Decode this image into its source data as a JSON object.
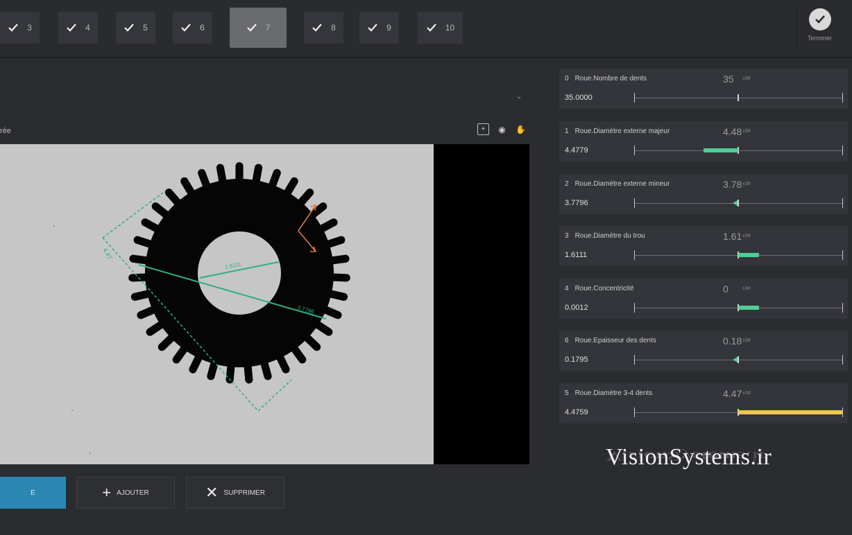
{
  "steps": [
    {
      "num": "3",
      "active": false
    },
    {
      "num": "4",
      "active": false
    },
    {
      "num": "5",
      "active": false
    },
    {
      "num": "6",
      "active": false
    },
    {
      "num": "7",
      "active": true
    },
    {
      "num": "8",
      "active": false
    },
    {
      "num": "9",
      "active": false
    },
    {
      "num": "10",
      "active": false
    }
  ],
  "finish_label": "Terminer",
  "view_title": "rée",
  "image": {
    "hole_dim": "1.6111",
    "outer_dim": "3.7796",
    "side_dim": "4.47",
    "teeth": 35
  },
  "buttons": {
    "primary_label": "E",
    "add_label": "AJOUTER",
    "delete_label": "SUPPRIMER"
  },
  "measurements": [
    {
      "id": "0",
      "name": "Roue.Nombre de dents",
      "nominal": "35",
      "unit": "±3#",
      "value": "35.0000",
      "indicator": {
        "type": "tick"
      }
    },
    {
      "id": "1",
      "name": "Roue.Diamètre externe majeur",
      "nominal": "4.48",
      "unit": "±3#",
      "value": "4.4779",
      "indicator": {
        "type": "bar",
        "from": -0.2,
        "to": 0,
        "color": "#4fcf92"
      }
    },
    {
      "id": "2",
      "name": "Roue.Diamètre externe mineur",
      "nominal": "3.78",
      "unit": "±3#",
      "value": "3.7796",
      "indicator": {
        "type": "marker",
        "at": -0.02
      }
    },
    {
      "id": "3",
      "name": "Roue.Diamètre du trou",
      "nominal": "1.61",
      "unit": "±3#",
      "value": "1.6111",
      "indicator": {
        "type": "bar",
        "from": 0,
        "to": 0.12,
        "color": "#4fcf92"
      }
    },
    {
      "id": "4",
      "name": "Roue.Concentricité",
      "nominal": "0",
      "unit": "±3#",
      "value": "0.0012",
      "indicator": {
        "type": "bar",
        "from": 0,
        "to": 0.12,
        "color": "#4fcf92"
      }
    },
    {
      "id": "6",
      "name": "Roue.Epaisseur des dents",
      "nominal": "0.18",
      "unit": "±3#",
      "value": "0.1795",
      "indicator": {
        "type": "marker",
        "at": -0.02
      }
    },
    {
      "id": "5",
      "name": "Roue.Diamètre 3-4 dents",
      "nominal": "4.47",
      "unit": "±3#",
      "value": "4.4759",
      "indicator": {
        "type": "bar",
        "from": 0,
        "to": 0.6,
        "color": "#f0c64a"
      }
    }
  ],
  "watermark": "VisionSystems.ir"
}
